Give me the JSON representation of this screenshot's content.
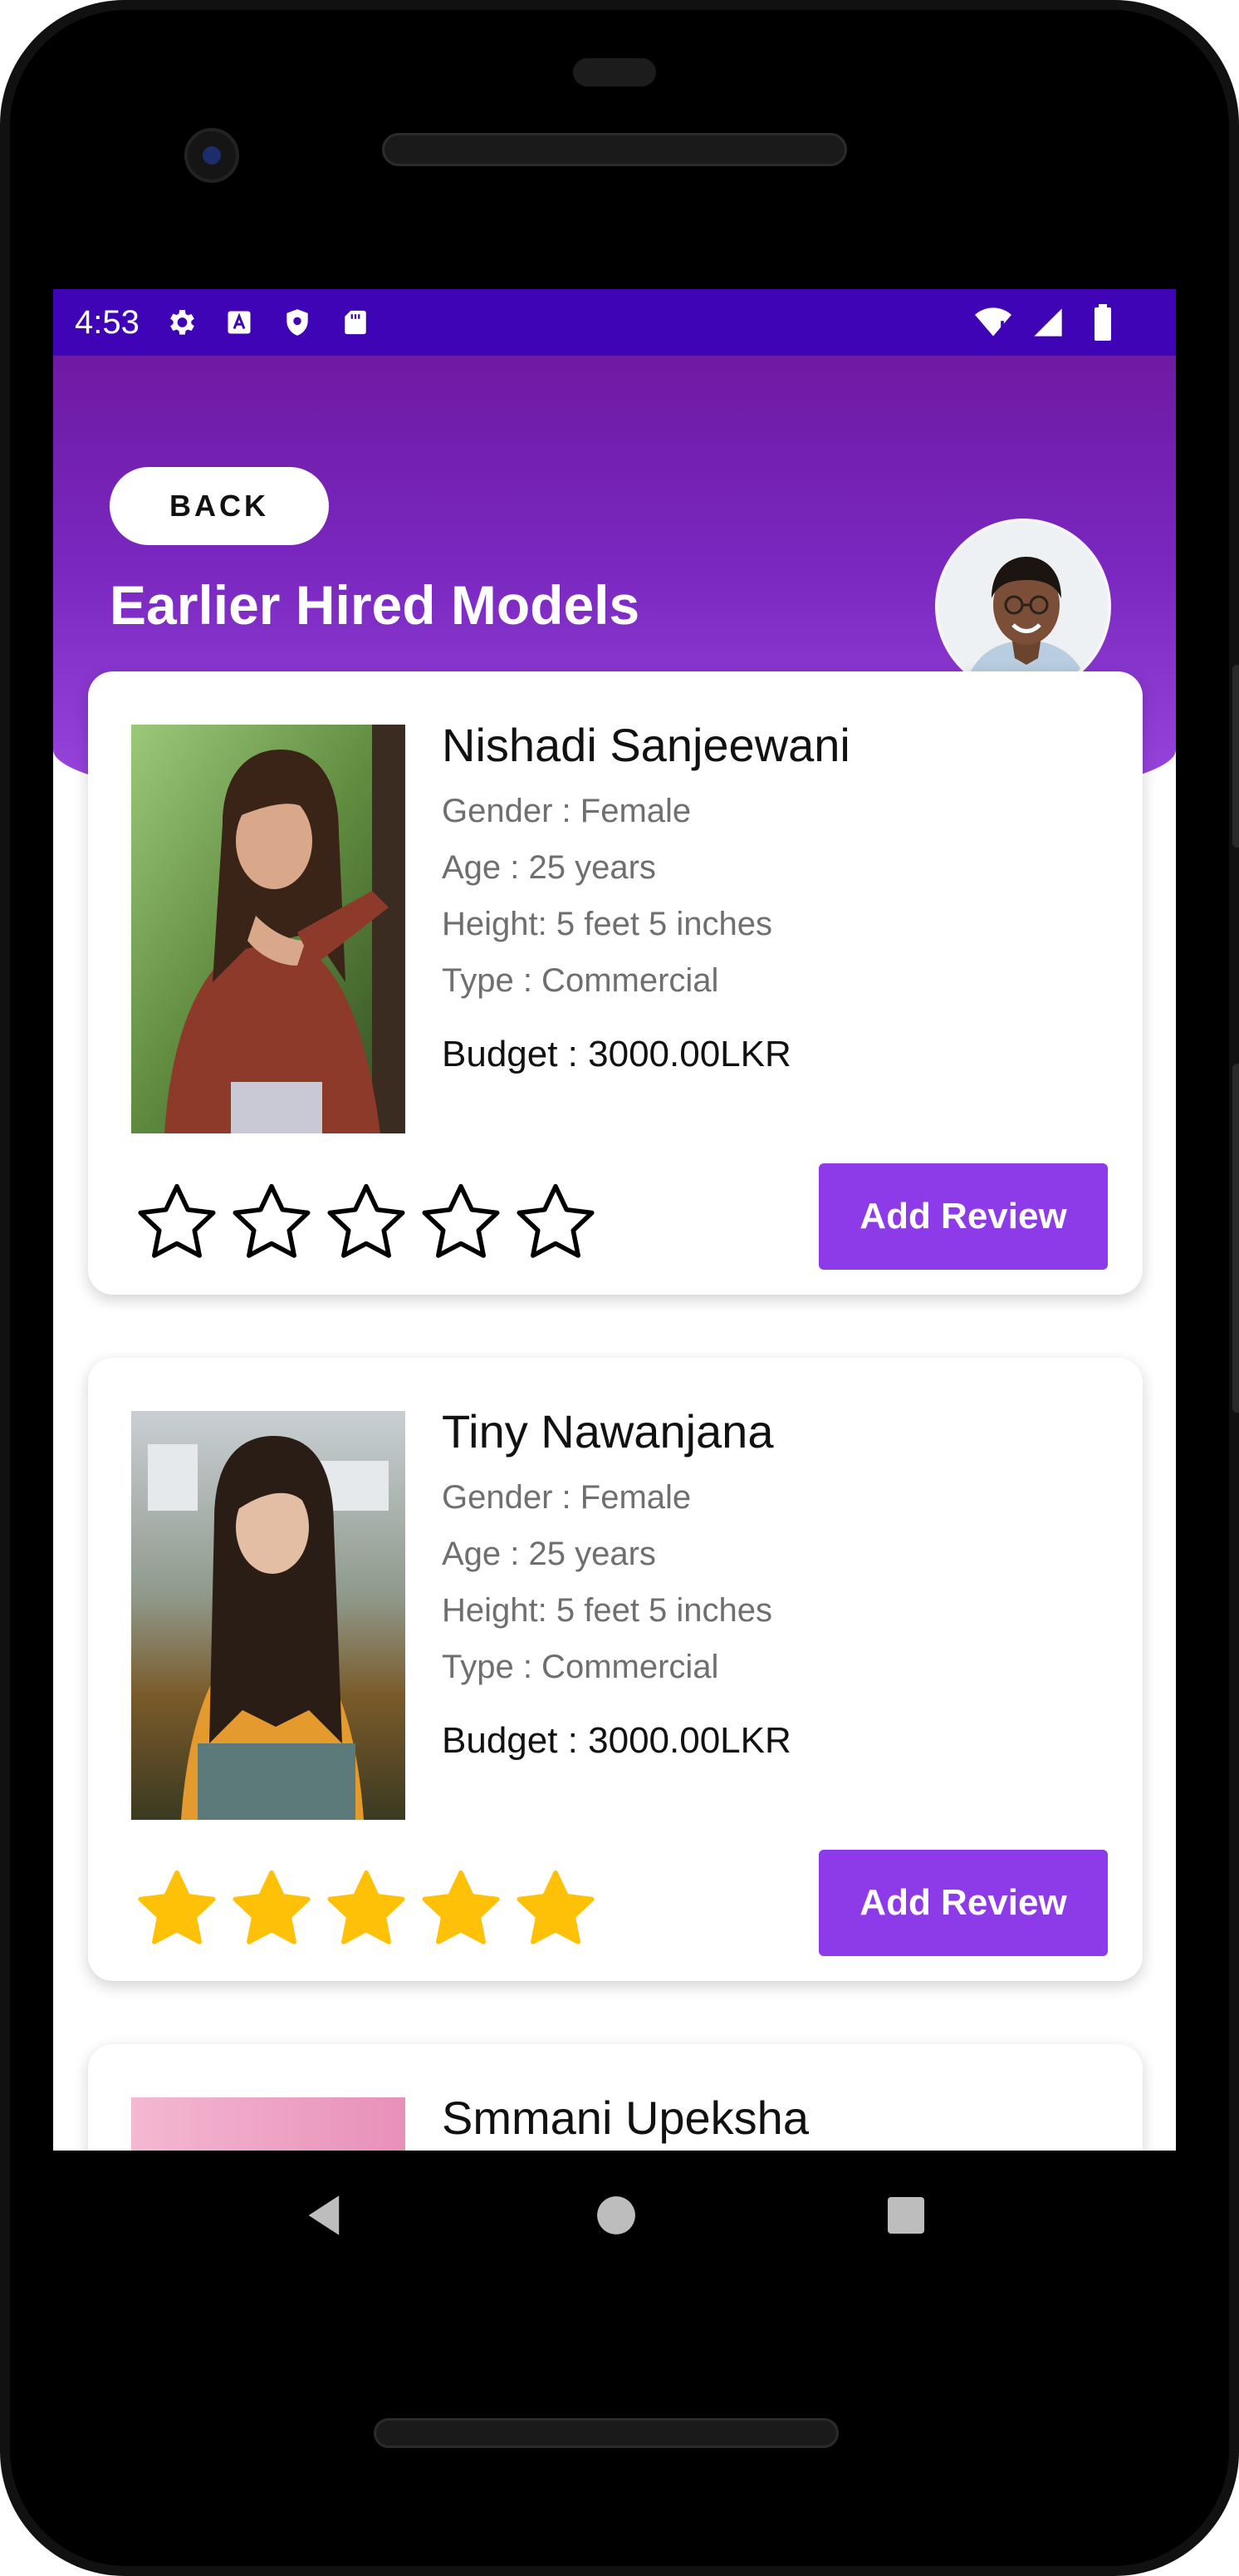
{
  "status_bar": {
    "time": "4:53",
    "left_icons": [
      "gear-icon",
      "a-box-icon",
      "shield-icon",
      "sd-card-icon"
    ],
    "right_icons": [
      "wifi-icon",
      "signal-icon",
      "battery-icon"
    ]
  },
  "header": {
    "back_label": "BACK",
    "title": "Earlier Hired Models"
  },
  "models": [
    {
      "name": "Nishadi Sanjeewani",
      "gender": "Gender : Female",
      "age": "Age : 25 years",
      "height": "Height: 5 feet 5 inches",
      "type": "Type : Commercial",
      "budget": "Budget : 3000.00LKR",
      "rating": 0,
      "review_label": "Add Review"
    },
    {
      "name": "Tiny Nawanjana",
      "gender": "Gender : Female",
      "age": "Age : 25 years",
      "height": "Height: 5 feet 5 inches",
      "type": "Type : Commercial",
      "budget": "Budget : 3000.00LKR",
      "rating": 5,
      "review_label": "Add Review"
    },
    {
      "name": "Smmani Upeksha"
    }
  ],
  "colors": {
    "status_bar": "#3e04b6",
    "header_top": "#6e1aa3",
    "header_bottom": "#9b49e0",
    "review_button": "#8d3be8",
    "star_filled": "#ffc107"
  },
  "nav": {
    "icons": [
      "back-icon",
      "home-icon",
      "recents-icon"
    ]
  }
}
